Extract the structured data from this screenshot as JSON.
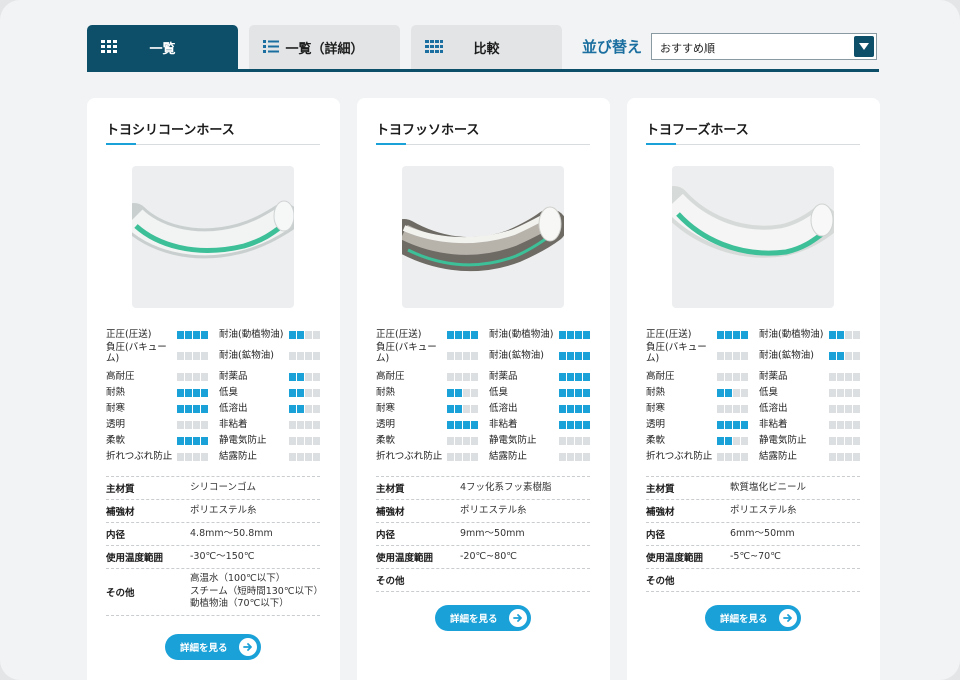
{
  "tabs": [
    {
      "label": "一覧",
      "active": true,
      "icon": "grid-icon"
    },
    {
      "label": "一覧（詳細）",
      "active": false,
      "icon": "list-icon"
    },
    {
      "label": "比較",
      "active": false,
      "icon": "compare-icon"
    }
  ],
  "sort": {
    "label": "並び替え",
    "selected": "おすすめ順"
  },
  "colors": {
    "accent": "#1aa1d8",
    "dark": "#0d4f69",
    "off": "#dcdfe1"
  },
  "cards": [
    {
      "title": "トヨシリコーンホース",
      "image": "hose-silicone",
      "props_left": [
        {
          "label": "正圧(圧送)",
          "rating": 4
        },
        {
          "label": "負圧(バキューム)",
          "rating": 0
        },
        {
          "label": "高耐圧",
          "rating": 0
        },
        {
          "label": "耐熱",
          "rating": 4
        },
        {
          "label": "耐寒",
          "rating": 4
        },
        {
          "label": "透明",
          "rating": 0
        },
        {
          "label": "柔軟",
          "rating": 4
        },
        {
          "label": "折れつぶれ防止",
          "rating": 0
        }
      ],
      "props_right": [
        {
          "label": "耐油(動植物油)",
          "rating": 2
        },
        {
          "label": "耐油(鉱物油)",
          "rating": 0
        },
        {
          "label": "耐薬品",
          "rating": 2
        },
        {
          "label": "低臭",
          "rating": 2
        },
        {
          "label": "低溶出",
          "rating": 2
        },
        {
          "label": "非粘着",
          "rating": 0
        },
        {
          "label": "静電気防止",
          "rating": 0
        },
        {
          "label": "結露防止",
          "rating": 0
        }
      ],
      "specs": [
        {
          "key": "主材質",
          "value": "シリコーンゴム"
        },
        {
          "key": "補強材",
          "value": "ポリエステル糸"
        },
        {
          "key": "内径",
          "value": "4.8mm～50.8mm"
        },
        {
          "key": "使用温度範囲",
          "value": "-30℃～150℃"
        },
        {
          "key": "その他",
          "value": [
            "高温水（100℃以下）",
            "スチーム（短時間130℃以下）",
            "動植物油（70℃以下）"
          ]
        }
      ],
      "button": "詳細を見る"
    },
    {
      "title": "トヨフッソホース",
      "image": "hose-fluoro",
      "props_left": [
        {
          "label": "正圧(圧送)",
          "rating": 4
        },
        {
          "label": "負圧(バキューム)",
          "rating": 0
        },
        {
          "label": "高耐圧",
          "rating": 0
        },
        {
          "label": "耐熱",
          "rating": 2
        },
        {
          "label": "耐寒",
          "rating": 2
        },
        {
          "label": "透明",
          "rating": 4
        },
        {
          "label": "柔軟",
          "rating": 0
        },
        {
          "label": "折れつぶれ防止",
          "rating": 0
        }
      ],
      "props_right": [
        {
          "label": "耐油(動植物油)",
          "rating": 4
        },
        {
          "label": "耐油(鉱物油)",
          "rating": 4
        },
        {
          "label": "耐薬品",
          "rating": 4
        },
        {
          "label": "低臭",
          "rating": 4
        },
        {
          "label": "低溶出",
          "rating": 4
        },
        {
          "label": "非粘着",
          "rating": 4
        },
        {
          "label": "静電気防止",
          "rating": 0
        },
        {
          "label": "結露防止",
          "rating": 0
        }
      ],
      "specs": [
        {
          "key": "主材質",
          "value": "4フッ化系フッ素樹脂"
        },
        {
          "key": "補強材",
          "value": "ポリエステル糸"
        },
        {
          "key": "内径",
          "value": "9mm～50mm"
        },
        {
          "key": "使用温度範囲",
          "value": "-20℃~80℃"
        },
        {
          "key": "その他",
          "value": []
        }
      ],
      "button": "詳細を見る"
    },
    {
      "title": "トヨフーズホース",
      "image": "hose-foods",
      "props_left": [
        {
          "label": "正圧(圧送)",
          "rating": 4
        },
        {
          "label": "負圧(バキューム)",
          "rating": 0
        },
        {
          "label": "高耐圧",
          "rating": 0
        },
        {
          "label": "耐熱",
          "rating": 2
        },
        {
          "label": "耐寒",
          "rating": 0
        },
        {
          "label": "透明",
          "rating": 4
        },
        {
          "label": "柔軟",
          "rating": 2
        },
        {
          "label": "折れつぶれ防止",
          "rating": 0
        }
      ],
      "props_right": [
        {
          "label": "耐油(動植物油)",
          "rating": 2
        },
        {
          "label": "耐油(鉱物油)",
          "rating": 2
        },
        {
          "label": "耐薬品",
          "rating": 0
        },
        {
          "label": "低臭",
          "rating": 0
        },
        {
          "label": "低溶出",
          "rating": 0
        },
        {
          "label": "非粘着",
          "rating": 0
        },
        {
          "label": "静電気防止",
          "rating": 0
        },
        {
          "label": "結露防止",
          "rating": 0
        }
      ],
      "specs": [
        {
          "key": "主材質",
          "value": "軟質塩化ビニール"
        },
        {
          "key": "補強材",
          "value": "ポリエステル糸"
        },
        {
          "key": "内径",
          "value": "6mm～50mm"
        },
        {
          "key": "使用温度範囲",
          "value": "-5℃~70℃"
        },
        {
          "key": "その他",
          "value": []
        }
      ],
      "button": "詳細を見る"
    }
  ]
}
